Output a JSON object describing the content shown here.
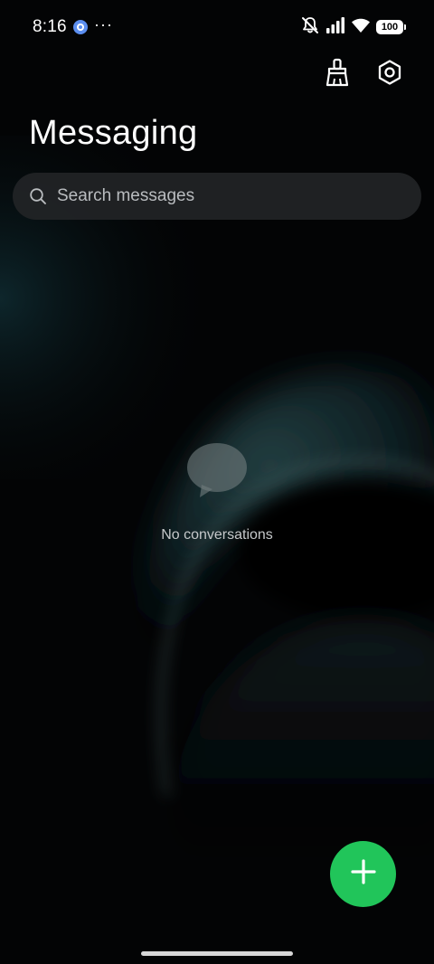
{
  "status_bar": {
    "time": "8:16",
    "more_indicator": "···",
    "battery_level": "100",
    "icons": [
      "app-notification-icon",
      "mute-icon",
      "signal-icon",
      "wifi-icon",
      "battery-icon"
    ]
  },
  "header": {
    "title": "Messaging",
    "actions": [
      {
        "name": "clean-up",
        "icon": "broom-icon"
      },
      {
        "name": "settings",
        "icon": "settings-hex-icon"
      }
    ]
  },
  "search": {
    "placeholder": "Search messages"
  },
  "empty_state": {
    "icon": "chat-bubble-icon",
    "text": "No conversations"
  },
  "fab": {
    "icon": "plus-icon",
    "color": "#21c55a"
  },
  "colors": {
    "background": "#030405",
    "search_bg": "#222426",
    "accent": "#21c55a",
    "muted_text": "#c5c8ca"
  }
}
